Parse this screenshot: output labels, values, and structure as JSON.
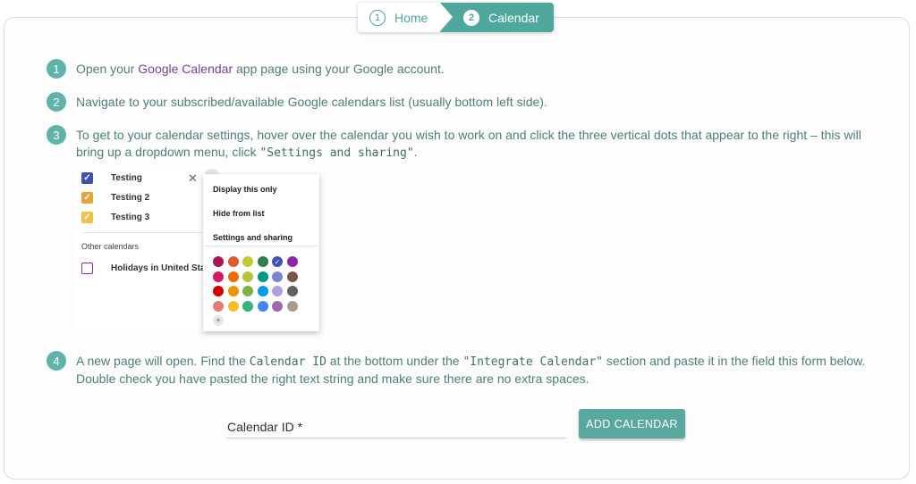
{
  "breadcrumb": {
    "steps": [
      {
        "num": "1",
        "label": "Home"
      },
      {
        "num": "2",
        "label": "Calendar"
      }
    ]
  },
  "instructions": {
    "step1": {
      "num": "1",
      "pre": "Open your ",
      "link": "Google Calendar",
      "post": " app page using your Google account."
    },
    "step2": {
      "num": "2",
      "text": "Navigate to your subscribed/available Google calendars list (usually bottom left side)."
    },
    "step3": {
      "num": "3",
      "pre": "To get to your calendar settings, hover over the calendar you wish to work on and click the three vertical dots that appear to the right – this will bring up a dropdown menu, click ",
      "code": "\"Settings and sharing\"",
      "post": "."
    },
    "step4": {
      "num": "4",
      "pre": "A new page will open. Find the ",
      "code1": "Calendar ID",
      "mid": " at the bottom under the ",
      "code2": "\"Integrate Calendar\"",
      "post": " section and paste it in the field this form below. Double check you have pasted the right text string and make sure there are no extra spaces."
    }
  },
  "screenshot": {
    "calendars": [
      {
        "name": "Testing",
        "color": "#3f51b5"
      },
      {
        "name": "Testing 2",
        "color": "#e8a33d"
      },
      {
        "name": "Testing 3",
        "color": "#f1c04d"
      }
    ],
    "other_label": "Other calendars",
    "other_calendars": [
      {
        "name": "Holidays in United State",
        "color": "#8e24aa"
      }
    ],
    "menu": [
      "Display this only",
      "Hide from list",
      "Settings and sharing"
    ],
    "swatch_colors": [
      "#ad1457",
      "#e05a2c",
      "#c0ca33",
      "#2e7d4f",
      "#3f51b5",
      "#8e24aa",
      "#d81b60",
      "#ef6c00",
      "#b7c23d",
      "#009688",
      "#7986cb",
      "#795548",
      "#d50000",
      "#f09300",
      "#7cb342",
      "#039be5",
      "#b39ddb",
      "#616161",
      "#e67c73",
      "#f6bf26",
      "#33b679",
      "#4285f4",
      "#9e69af",
      "#a79b8e"
    ],
    "selected_swatch": 4,
    "add_glyph": "+",
    "check_glyph": "✓",
    "close_glyph": "✕"
  },
  "form": {
    "calendar_id_label": "Calendar ID *",
    "calendar_id_value": "",
    "add_button": "ADD CALENDAR"
  },
  "colors": {
    "accent": "#58a89f",
    "link": "#7c3c98"
  }
}
